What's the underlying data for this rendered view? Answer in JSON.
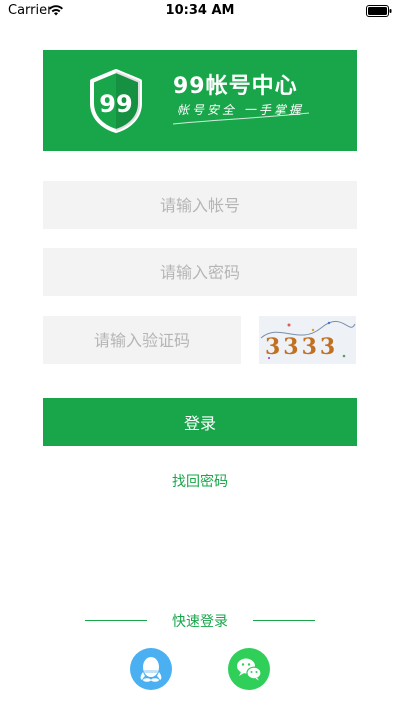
{
  "status_bar": {
    "carrier": "Carrier",
    "time": "10:34 AM"
  },
  "banner": {
    "logo_text": "99",
    "title": "99帐号中心",
    "slogan": "帐号安全 一手掌握"
  },
  "form": {
    "account_placeholder": "请输入帐号",
    "password_placeholder": "请输入密码",
    "captcha_placeholder": "请输入验证码",
    "captcha_text": "3333",
    "login_label": "登录",
    "forgot_label": "找回密码"
  },
  "quick_login": {
    "title": "快速登录",
    "providers": [
      {
        "name": "qq",
        "icon": "qq-penguin-icon",
        "color": "#4ab0f2"
      },
      {
        "name": "wechat",
        "icon": "wechat-icon",
        "color": "#2fcf5a"
      }
    ]
  },
  "colors": {
    "brand": "#19a64a",
    "input_bg": "#f3f3f3",
    "placeholder": "#b5b5b5"
  }
}
